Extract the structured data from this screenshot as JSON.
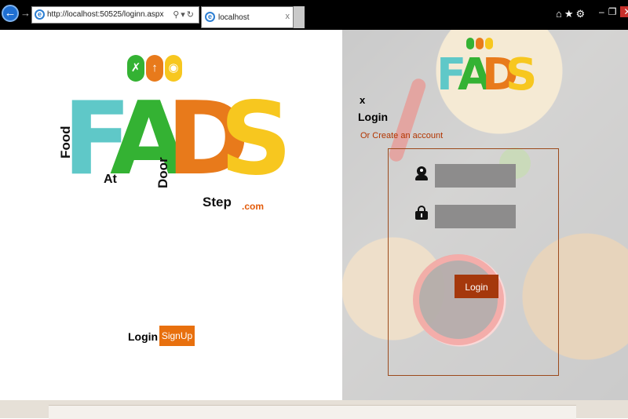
{
  "browser": {
    "url": "http://localhost:50525/loginn.aspx",
    "tab_title": "localhost",
    "tab_close": "x",
    "icons": [
      "back-arrow-icon",
      "forward-arrow-icon",
      "ie-logo-icon",
      "search-icon",
      "refresh-icon",
      "home-icon",
      "favorites-star-icon",
      "settings-gear-icon"
    ],
    "window_controls": [
      "minimize",
      "restore",
      "close"
    ]
  },
  "logo": {
    "letters": [
      "F",
      "A",
      "D",
      "S"
    ],
    "words": [
      "Food",
      "At",
      "Door",
      "Step"
    ],
    "suffix": ".com",
    "colors": {
      "F": "#5fc8c8",
      "A": "#34b233",
      "D": "#e87a1b",
      "S": "#f7c71f",
      "circle1": "#34b233",
      "circle2": "#e87a1b",
      "circle3": "#f7c71f"
    },
    "circle_icons": [
      "fork-icon",
      "knife-icon",
      "spoon-icon"
    ]
  },
  "nav": {
    "login": "Login",
    "signup": "SignUp",
    "signup_color": "#e8700e"
  },
  "login_form": {
    "close": "x",
    "title": "Login",
    "create_account": "Or Create an account",
    "username_value": "",
    "password_value": "",
    "button": "Login",
    "button_color": "#a5380c",
    "border_color": "#9c4a1c"
  }
}
